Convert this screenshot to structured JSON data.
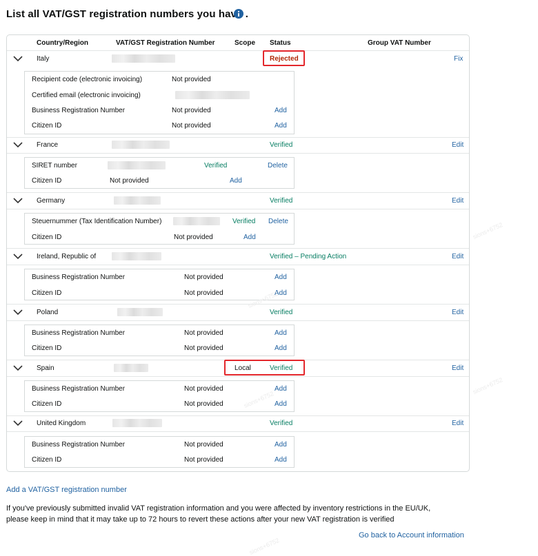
{
  "page": {
    "title": "List all VAT/GST registration numbers you have ."
  },
  "table": {
    "headers": {
      "country": "Country/Region",
      "number": "VAT/GST Registration Number",
      "scope": "Scope",
      "status": "Status",
      "group": "Group VAT Number"
    },
    "rows": [
      {
        "country": "Italy",
        "status": "Rejected",
        "action": "Fix",
        "details": [
          {
            "label": "Recipient code (electronic invoicing)",
            "value": "Not provided"
          },
          {
            "label": "Certified email (electronic invoicing)"
          },
          {
            "label": "Business Registration Number",
            "value": "Not provided",
            "action": "Add"
          },
          {
            "label": "Citizen ID",
            "value": "Not provided",
            "action": "Add"
          }
        ]
      },
      {
        "country": "France",
        "status": "Verified",
        "action": "Edit",
        "details": [
          {
            "label": "SIRET number",
            "status": "Verified",
            "action": "Delete"
          },
          {
            "label": "Citizen ID",
            "value": "Not provided",
            "action": "Add"
          }
        ]
      },
      {
        "country": "Germany",
        "status": "Verified",
        "action": "Edit",
        "details": [
          {
            "label": "Steuernummer (Tax Identification Number)",
            "status": "Verified",
            "action": "Delete"
          },
          {
            "label": "Citizen ID",
            "value": "Not provided",
            "action": "Add"
          }
        ]
      },
      {
        "country": "Ireland, Republic of",
        "status": "Verified – Pending Action",
        "action": "Edit",
        "details": [
          {
            "label": "Business Registration Number",
            "value": "Not provided",
            "action": "Add"
          },
          {
            "label": "Citizen ID",
            "value": "Not provided",
            "action": "Add"
          }
        ]
      },
      {
        "country": "Poland",
        "status": "Verified",
        "action": "Edit",
        "details": [
          {
            "label": "Business Registration Number",
            "value": "Not provided",
            "action": "Add"
          },
          {
            "label": "Citizen ID",
            "value": "Not provided",
            "action": "Add"
          }
        ]
      },
      {
        "country": "Spain",
        "scope": "Local",
        "status": "Verified",
        "action": "Edit",
        "details": [
          {
            "label": "Business Registration Number",
            "value": "Not provided",
            "action": "Add"
          },
          {
            "label": "Citizen ID",
            "value": "Not provided",
            "action": "Add"
          }
        ]
      },
      {
        "country": "United Kingdom",
        "status": "Verified",
        "action": "Edit",
        "details": [
          {
            "label": "Business Registration Number",
            "value": "Not provided",
            "action": "Add"
          },
          {
            "label": "Citizen ID",
            "value": "Not provided",
            "action": "Add"
          }
        ]
      }
    ]
  },
  "links": {
    "add_vat": "Add a VAT/GST registration number",
    "go_back": "Go back to Account information"
  },
  "notice": {
    "line1": "If you've previously submitted invalid VAT registration information and you were affected by inventory restrictions in the EU/UK,",
    "line2": "please keep in mind that it may take up to 72 hours to revert these actions after your new VAT registration is verified"
  },
  "watermark": "sions+6752",
  "icons": {
    "info": "info-icon",
    "chevron": "chevron-down-icon"
  },
  "colors": {
    "link": "#2162a1",
    "verified": "#067d62",
    "rejected": "#b12704",
    "highlight": "#e3262b"
  }
}
